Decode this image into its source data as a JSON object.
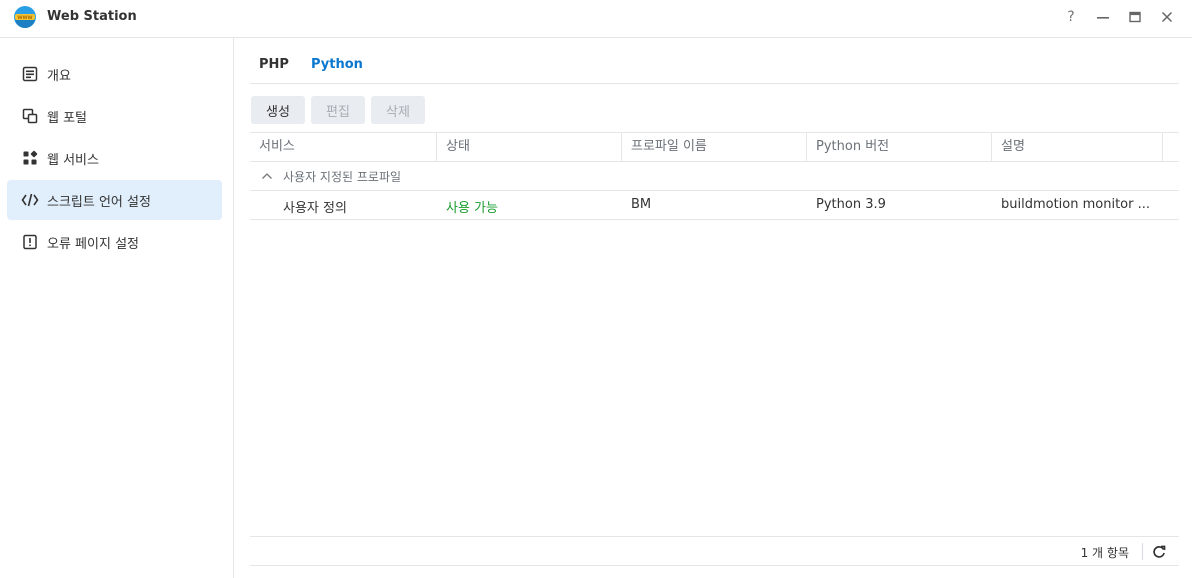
{
  "window": {
    "title": "Web Station",
    "logo_text": "WWW",
    "help_icon": "question-mark-icon",
    "minimize_icon": "minimize-icon",
    "maximize_icon": "maximize-icon",
    "close_icon": "close-icon"
  },
  "sidebar": {
    "items": [
      {
        "label": "개요",
        "icon": "overview-icon"
      },
      {
        "label": "웹 포털",
        "icon": "web-portal-icon"
      },
      {
        "label": "웹 서비스",
        "icon": "web-service-icon"
      },
      {
        "label": "스크립트 언어 설정",
        "icon": "code-icon",
        "active": true
      },
      {
        "label": "오류 페이지 설정",
        "icon": "error-page-icon"
      }
    ]
  },
  "tabs": [
    {
      "label": "PHP"
    },
    {
      "label": "Python",
      "active": true
    }
  ],
  "toolbar": {
    "create_label": "생성",
    "edit_label": "편집",
    "delete_label": "삭제"
  },
  "table": {
    "columns": [
      "서비스",
      "상태",
      "프로파일 이름",
      "Python 버전",
      "설명"
    ],
    "group_label": "사용자 지정된 프로파일",
    "rows": [
      {
        "service": "사용자 정의",
        "status": "사용 가능",
        "profile_name": "BM",
        "python_version": "Python 3.9",
        "description": "buildmotion monitor ..."
      }
    ]
  },
  "footer": {
    "count_text": "1 개 항목"
  },
  "colors": {
    "accent": "#0b78d0",
    "active_bg": "#e1eefb",
    "status_ok": "#1d9e31",
    "border": "#e4e6ea"
  }
}
